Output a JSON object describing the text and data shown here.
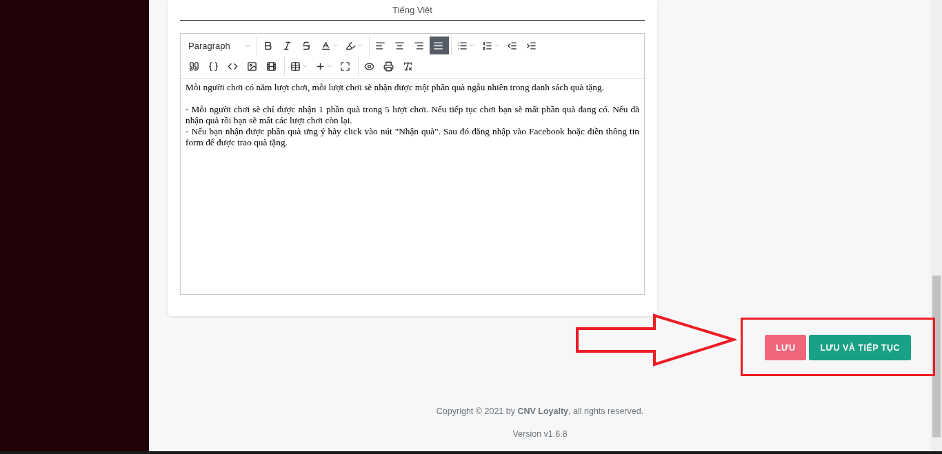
{
  "language_tab": {
    "label": "Tiếng Việt",
    "selected": true
  },
  "editor": {
    "format_select": "Paragraph",
    "toolbar_rows": [
      [
        [
          {
            "kind": "bold",
            "selected": false,
            "dropdown": false
          },
          {
            "kind": "italic",
            "selected": false,
            "dropdown": false
          },
          {
            "kind": "strike",
            "selected": false,
            "dropdown": false
          },
          {
            "kind": "textcolor",
            "selected": false,
            "dropdown": true
          },
          {
            "kind": "highlight",
            "selected": false,
            "dropdown": true
          }
        ],
        [
          {
            "kind": "alignleft",
            "selected": false,
            "dropdown": false
          },
          {
            "kind": "aligncenter",
            "selected": false,
            "dropdown": false
          },
          {
            "kind": "alignright",
            "selected": false,
            "dropdown": false
          },
          {
            "kind": "justify",
            "selected": true,
            "dropdown": false
          }
        ],
        [
          {
            "kind": "bullets",
            "selected": false,
            "dropdown": true
          },
          {
            "kind": "numbers",
            "selected": false,
            "dropdown": true
          },
          {
            "kind": "outdent",
            "selected": false,
            "dropdown": false
          },
          {
            "kind": "indent",
            "selected": false,
            "dropdown": false
          }
        ]
      ],
      [
        [
          {
            "kind": "quote",
            "selected": false,
            "dropdown": false
          },
          {
            "kind": "braces",
            "selected": false,
            "dropdown": false
          },
          {
            "kind": "code",
            "selected": false,
            "dropdown": false
          },
          {
            "kind": "image",
            "selected": false,
            "dropdown": false
          },
          {
            "kind": "video",
            "selected": false,
            "dropdown": false
          }
        ],
        [
          {
            "kind": "table",
            "selected": false,
            "dropdown": true
          },
          {
            "kind": "insert",
            "selected": false,
            "dropdown": true
          },
          {
            "kind": "fullscreen",
            "selected": false,
            "dropdown": false
          }
        ],
        [
          {
            "kind": "preview",
            "selected": false,
            "dropdown": false
          },
          {
            "kind": "print",
            "selected": false,
            "dropdown": false
          },
          {
            "kind": "clearformat",
            "selected": false,
            "dropdown": false
          }
        ]
      ]
    ],
    "blocks": [
      [
        "Mỗi người chơi có năm lượt chơi, mỗi lượt chơi sẽ nhận được một phần quà ngẫu nhiên trong danh sách quà tặng."
      ],
      [
        "- Mỗi người chơi sẽ chỉ được nhận 1 phần quà trong 5 lượt chơi. Nếu tiếp tục chơi bạn sẽ mất phần quà đang có. Nếu đã nhận quà rồi bạn sẽ mất các lượt chơi còn lại.",
        "- Nếu bạn nhận được phần quà ưng ý hãy click vào nút \"Nhận quà\". Sau đó đăng nhập vào Facebook hoặc điền thông tin form để được trao quà tặng."
      ]
    ]
  },
  "buttons": [
    {
      "label": "LƯU",
      "kind": "save"
    },
    {
      "label": "LƯU VÀ TIẾP TỤC",
      "kind": "continue"
    }
  ],
  "footer": {
    "copyright": "Copyright © 2021 by **CNV Loyalty**, all rights reserved.",
    "version": "Version v1.6.8"
  }
}
